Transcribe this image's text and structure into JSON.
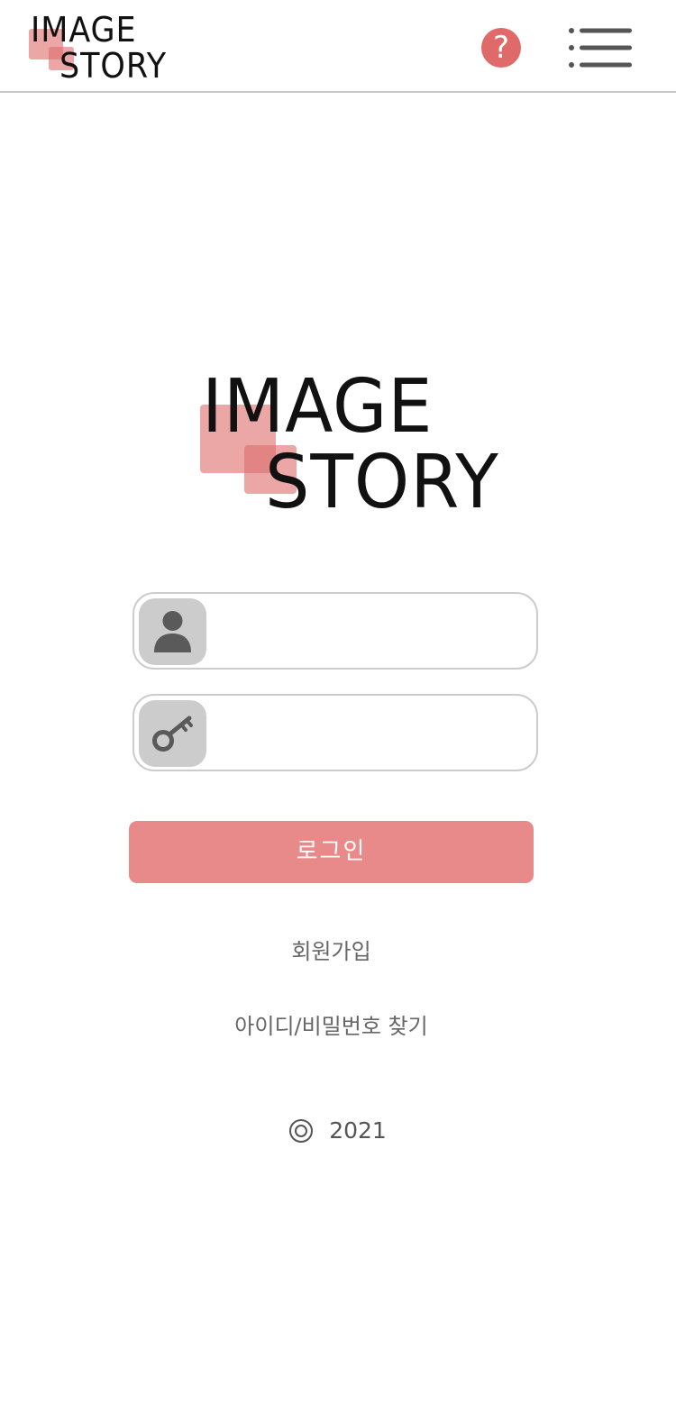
{
  "header": {
    "logo_line1": "IMAGE",
    "logo_line2": "STORY",
    "help_label": "?",
    "help_icon": "question-circle-icon",
    "menu_icon": "hamburger-menu-icon"
  },
  "main_logo": {
    "line1": "IMAGE",
    "line2": "STORY"
  },
  "login_form": {
    "id_field": {
      "icon": "user-icon",
      "value": "",
      "placeholder": ""
    },
    "password_field": {
      "icon": "key-icon",
      "value": "",
      "placeholder": ""
    },
    "login_button_label": "로그인"
  },
  "links": {
    "signup": "회원가입",
    "find_account": "아이디/비밀번호 찾기"
  },
  "footer": {
    "year": "2021"
  },
  "colors": {
    "accent": "#e06a6a",
    "button": "#e98a8a",
    "logo_square": "#e49a9a",
    "icon_box": "#cccccc",
    "icon_fg": "#5a5a5a"
  }
}
